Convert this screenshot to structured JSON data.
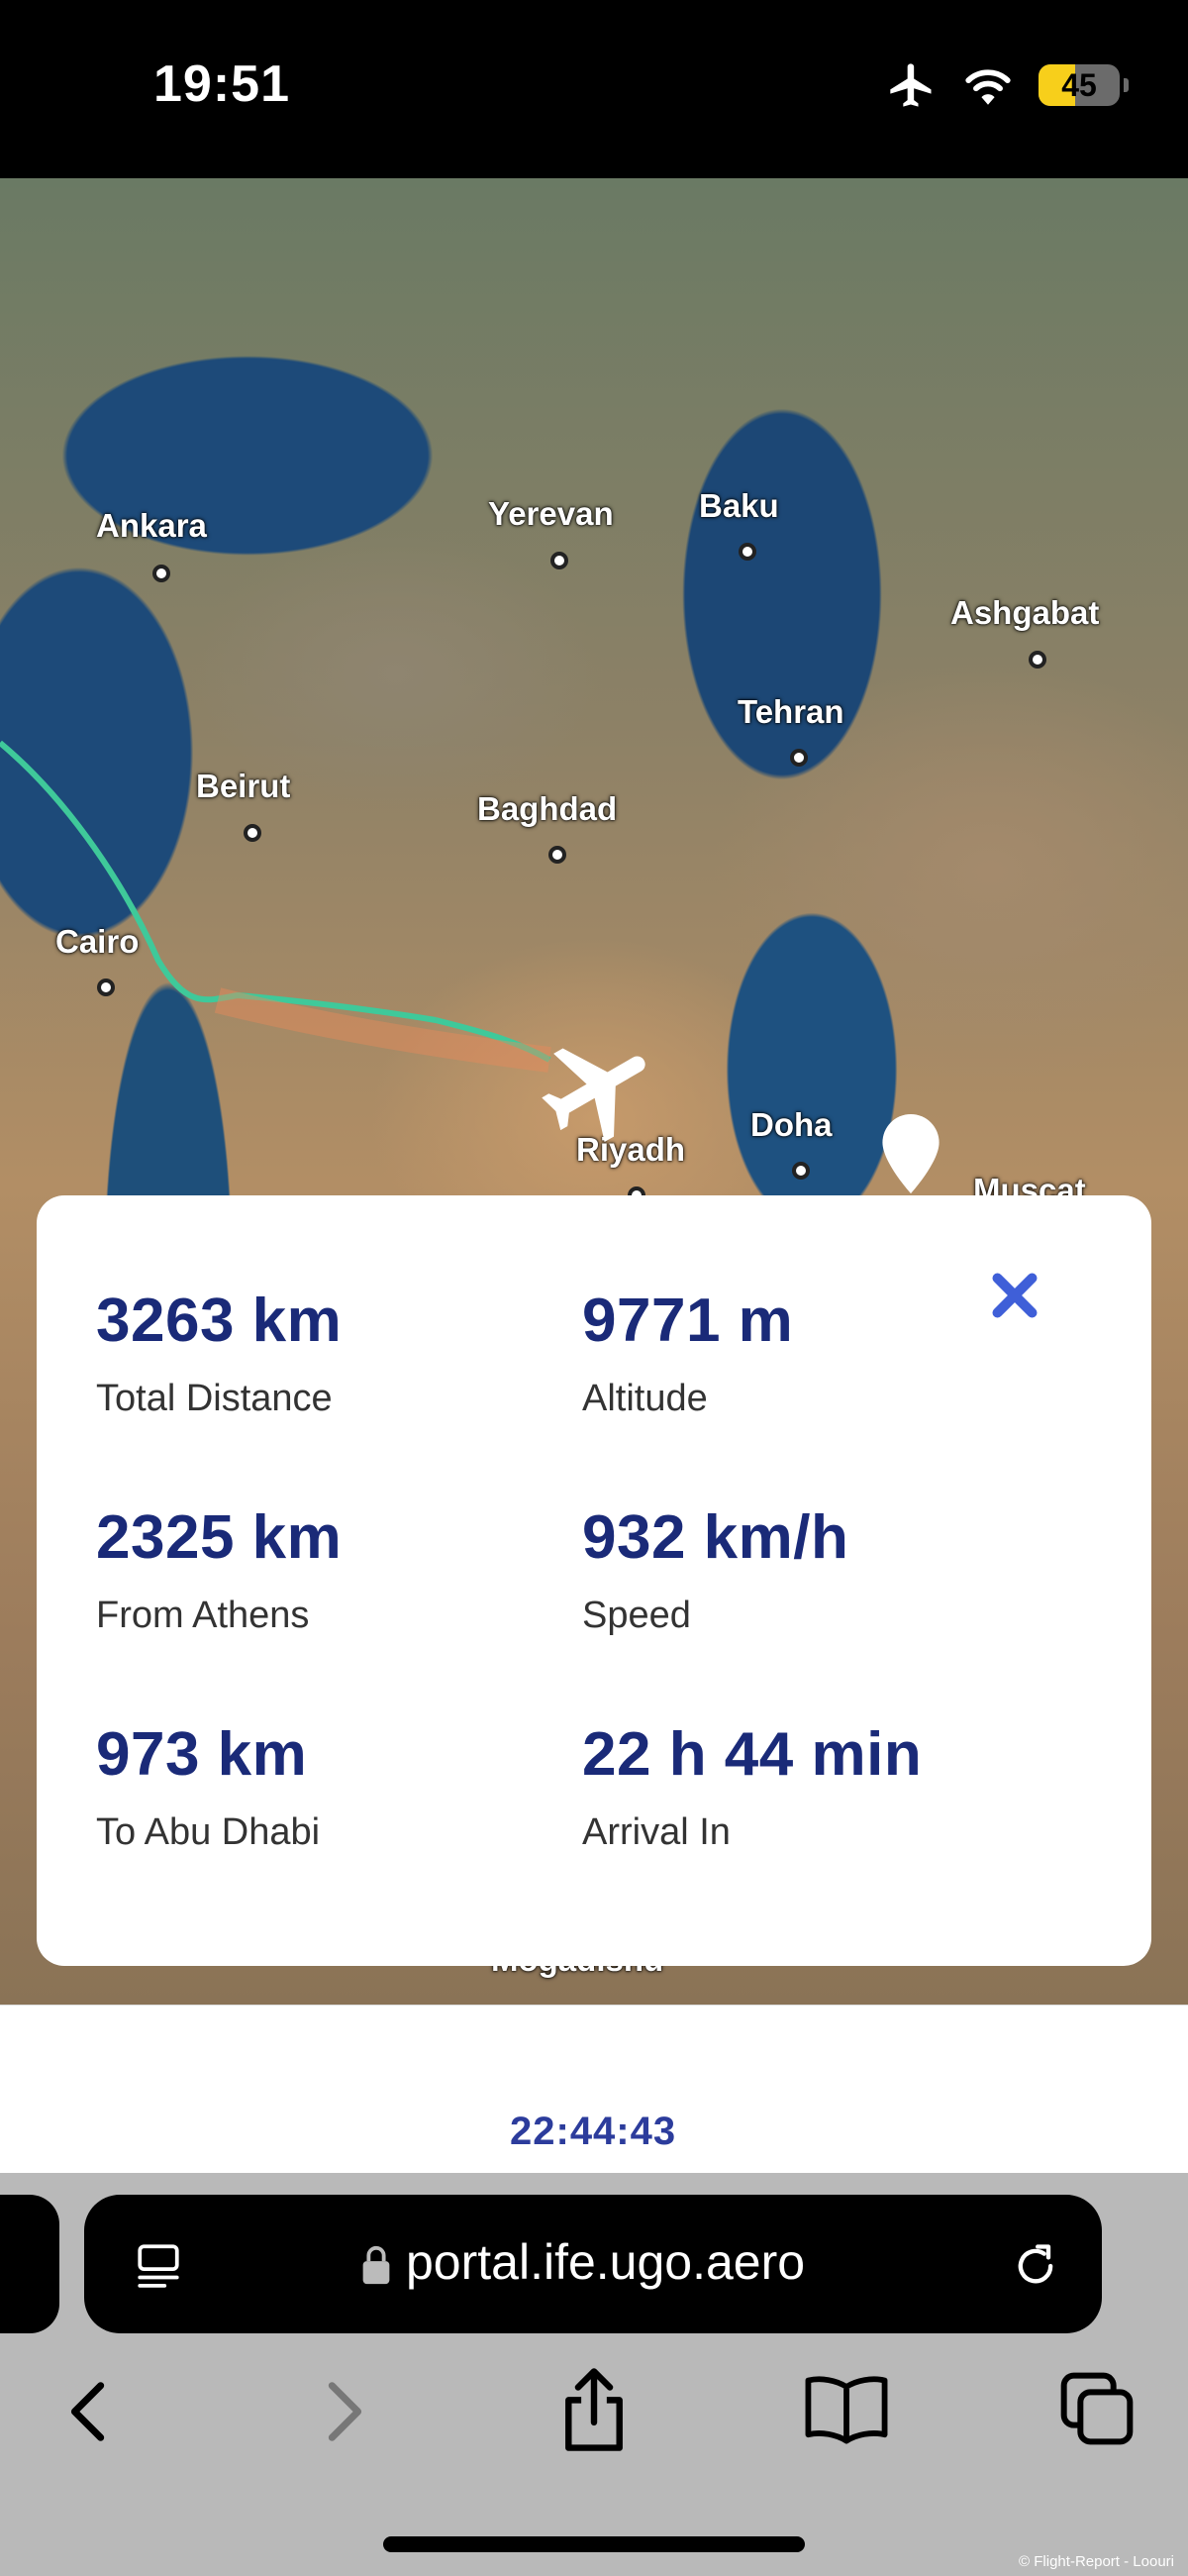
{
  "status_bar": {
    "time": "19:51",
    "battery_level": "45"
  },
  "map": {
    "cities": [
      {
        "name": "Ankara"
      },
      {
        "name": "Yerevan"
      },
      {
        "name": "Baku"
      },
      {
        "name": "Ashgabat"
      },
      {
        "name": "Tehran"
      },
      {
        "name": "Beirut"
      },
      {
        "name": "Baghdad"
      },
      {
        "name": "Cairo"
      },
      {
        "name": "Riyadh"
      },
      {
        "name": "Doha"
      },
      {
        "name": "Muscat"
      },
      {
        "name": "Mogadishu"
      }
    ],
    "route_colors": {
      "flown": "#3fc99a",
      "remaining": "#e8895a"
    }
  },
  "flight_info": {
    "total_distance": {
      "value": "3263 km",
      "label": "Total Distance"
    },
    "altitude": {
      "value": "9771 m",
      "label": "Altitude"
    },
    "from_origin": {
      "value": "2325 km",
      "label": "From Athens"
    },
    "speed": {
      "value": "932 km/h",
      "label": "Speed"
    },
    "to_destination": {
      "value": "973 km",
      "label": "To Abu Dhabi"
    },
    "arrival_in": {
      "value": "22 h 44 min",
      "label": "Arrival In"
    }
  },
  "bottom_nav": {
    "items": [
      {
        "icon": "home-icon"
      },
      {
        "icon": "crew-icon"
      },
      {
        "icon": "airplane-icon"
      },
      {
        "icon": "play-icon"
      },
      {
        "icon": "menu-icon"
      }
    ],
    "flight_timer": "22:44:43",
    "accent_color": "#2c3c9c"
  },
  "browser": {
    "url": "portal.ife.ugo.aero"
  },
  "footer": {
    "copyright": "© Flight-Report - Loouri"
  }
}
